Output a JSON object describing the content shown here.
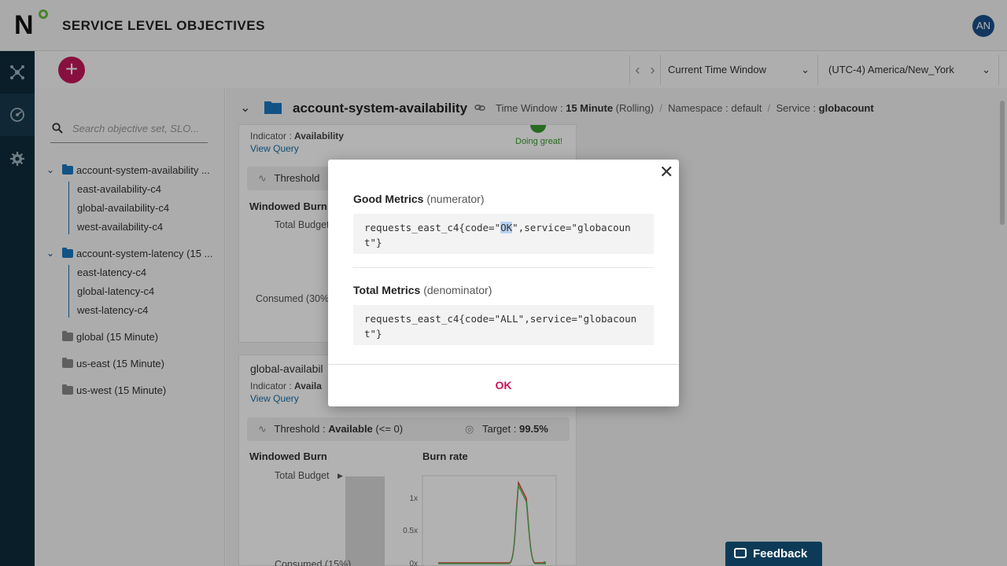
{
  "app": {
    "logo_letter": "N",
    "title": "SERVICE LEVEL OBJECTIVES",
    "user_initials": "AN"
  },
  "toolbar": {
    "add_symbol": "+",
    "prev_symbol": "‹",
    "next_symbol": "›",
    "time_window": "Current Time Window",
    "timezone": "(UTC-4) America/New_York"
  },
  "sidebar": {
    "search_placeholder": "Search objective set, SLO...",
    "tree": [
      {
        "label": "account-system-availability ...",
        "children": [
          "east-availability-c4",
          "global-availability-c4",
          "west-availability-c4"
        ]
      },
      {
        "label": "account-system-latency (15 ...",
        "children": [
          "east-latency-c4",
          "global-latency-c4",
          "west-latency-c4"
        ]
      },
      {
        "label": "global (15 Minute)"
      },
      {
        "label": "us-east (15 Minute)"
      },
      {
        "label": "us-west (15 Minute)"
      }
    ]
  },
  "main": {
    "set_title": "account-system-availability",
    "meta": {
      "time_window_label": "Time Window : ",
      "time_window_value": "15 Minute",
      "time_window_suffix": " (Rolling)",
      "namespace": "Namespace : default",
      "service_label": "Service : ",
      "service_value": "globacount"
    },
    "card1": {
      "indicator_label": "Indicator : ",
      "indicator_value": "Availability",
      "view_query": "View Query",
      "status": "Doing great!",
      "threshold_label": "Threshold",
      "windowed_burn": "Windowed Burn",
      "total_budget": "Total Budget",
      "consumed": "Consumed (30%"
    },
    "card2": {
      "name": "global-availabil",
      "indicator_label": "Indicator : ",
      "indicator_value": "Availa",
      "view_query": "View Query",
      "threshold_label": "Threshold : ",
      "threshold_value": "Available",
      "threshold_suffix": " (<= 0)",
      "target_label": "Target : ",
      "target_value": "99.5%",
      "windowed_burn": "Windowed Burn",
      "burn_rate": "Burn rate",
      "total_budget": "Total Budget",
      "consumed": "Consumed (15%)",
      "chart_ticks": [
        "1x",
        "0.5x",
        "0x"
      ]
    }
  },
  "modal": {
    "close_symbol": "✕",
    "good_label": "Good Metrics",
    "good_sub": "(numerator)",
    "good_query_pre": "requests_east_c4{code=\"",
    "good_query_sel": "OK",
    "good_query_post": "\",service=\"globacount\"}",
    "total_label": "Total Metrics",
    "total_sub": "(denominator)",
    "total_query": "requests_east_c4{code=\"ALL\",service=\"globacount\"}",
    "ok_button": "OK"
  },
  "feedback": {
    "label": "Feedback"
  },
  "colors": {
    "accent": "#c2185b",
    "rail": "#0d2b3a",
    "link": "#1b6fa8",
    "success": "#3a9a2e"
  }
}
